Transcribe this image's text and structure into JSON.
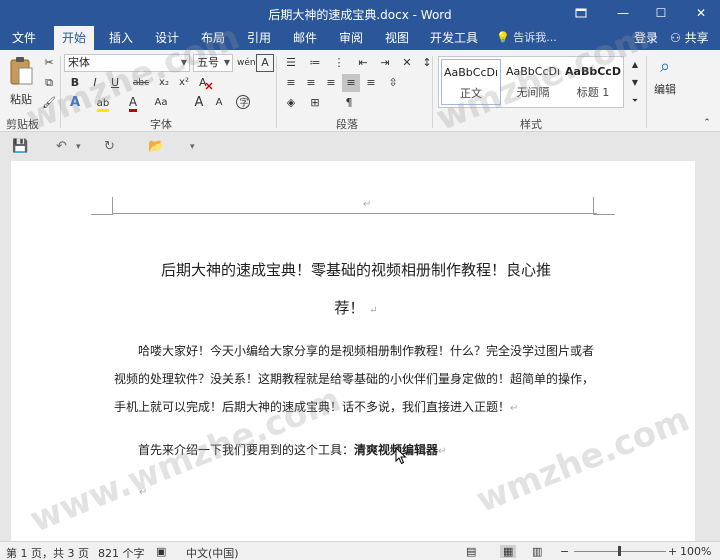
{
  "titlebar": {
    "title": "后期大神的速成宝典.docx - Word",
    "restore_icon": "restore-down-icon",
    "minimize": "—",
    "maximize": "☐",
    "close": "✕"
  },
  "tabs": [
    "文件",
    "开始",
    "插入",
    "设计",
    "布局",
    "引用",
    "邮件",
    "审阅",
    "视图",
    "开发工具"
  ],
  "active_tab": "开始",
  "tell_me": "告诉我...",
  "login": "登录",
  "share": "共享",
  "ribbon": {
    "paste_label": "粘贴",
    "clipboard_label": "剪贴板",
    "font_name": "宋体",
    "font_size": "五号",
    "font_group_label": "字体",
    "paragraph_group_label": "段落",
    "styles_group_label": "样式",
    "editing_label": "编辑",
    "styles": [
      {
        "preview": "AaBbCcDı",
        "name": "正文"
      },
      {
        "preview": "AaBbCcDı",
        "name": "无间隔"
      },
      {
        "preview": "AaBbCcD",
        "name": "标题 1"
      }
    ],
    "bold": "B",
    "italic": "I",
    "underline": "U",
    "strike": "abc",
    "subscript": "x₂",
    "superscript": "x²",
    "font_color_letter": "A",
    "highlight_letter": "ab",
    "case_label": "Aa",
    "grow_font": "A",
    "shrink_font": "A",
    "char_border": "A",
    "phonetic": "wén"
  },
  "document": {
    "title_line1": "后期大神的速成宝典！零基础的视频相册制作教程！良心推",
    "title_line2": "荐！",
    "para1_line1": "哈喽大家好！今天小编给大家分享的是视频相册制作教程！什么？完全没学过图片或者",
    "para1_line2": "视频的处理软件？没关系！这期教程就是给零基础的小伙伴们量身定做的！超简单的操作，",
    "para1_line3": "手机上就可以完成！后期大神的速成宝典！话不多说，我们直接进入正题！",
    "para2_prefix": "首先来介绍一下我们要用到的这个工具：",
    "para2_bold": "清爽视频编辑器",
    "paragraph_mark": "↵"
  },
  "status": {
    "page": "第 1 页，共 3 页",
    "words": "821 个字",
    "language": "中文(中国)",
    "zoom": "100%",
    "minus": "−",
    "plus": "+"
  },
  "watermark": "www.wmzhe.com"
}
